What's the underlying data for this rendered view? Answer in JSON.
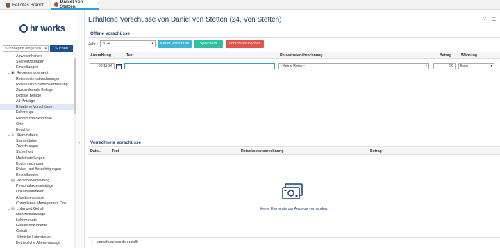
{
  "tabs": [
    {
      "label": "Felicitas Brandt"
    },
    {
      "label": "Daniel von Stetten",
      "close": "×"
    }
  ],
  "sidebar": {
    "logo": "hr works",
    "search_placeholder": "Suchbegriff eingeben",
    "search_button": "Suchen",
    "items": [
      {
        "label": "Abwesenheiten",
        "kind": "item"
      },
      {
        "label": "Stellvertretungen",
        "kind": "item"
      },
      {
        "label": "Einstellungen",
        "kind": "item"
      },
      {
        "label": "Reisemanagement",
        "kind": "group",
        "icon": "briefcase-icon"
      },
      {
        "label": "Reisekostenabrechnungen",
        "kind": "item"
      },
      {
        "label": "Reisekosten Sammelerfassung",
        "kind": "item"
      },
      {
        "label": "Zuzuordnende Belege",
        "kind": "item"
      },
      {
        "label": "Digitale Belege",
        "kind": "item"
      },
      {
        "label": "A1-Anträge",
        "kind": "item"
      },
      {
        "label": "Erhaltene Vorschüsse",
        "kind": "item",
        "selected": true
      },
      {
        "label": "Fahrzeuge",
        "kind": "item"
      },
      {
        "label": "Führerscheinkontrolle",
        "kind": "item"
      },
      {
        "label": "Orte",
        "kind": "item"
      },
      {
        "label": "Berichte",
        "kind": "item"
      },
      {
        "label": "Stammdaten",
        "kind": "group",
        "icon": "person-icon"
      },
      {
        "label": "Stammdaten",
        "kind": "item"
      },
      {
        "label": "Zuordnungen",
        "kind": "item"
      },
      {
        "label": "Sicherheit",
        "kind": "item"
      },
      {
        "label": "Maileinstellungen",
        "kind": "item"
      },
      {
        "label": "Kostenrechnung",
        "kind": "item"
      },
      {
        "label": "Rollen und Berechtigungen",
        "kind": "item"
      },
      {
        "label": "Einstellungen",
        "kind": "item"
      },
      {
        "label": "Personalverwaltung",
        "kind": "group",
        "icon": "idcard-icon"
      },
      {
        "label": "Personalakteneinträge",
        "kind": "item"
      },
      {
        "label": "Dokumentenkorb",
        "kind": "item"
      },
      {
        "label": "Arbeitszeugnisse",
        "kind": "item"
      },
      {
        "label": "Compliance Management Dok...",
        "kind": "item"
      },
      {
        "label": "Lohn und Gehalt",
        "kind": "group",
        "icon": "money-icon"
      },
      {
        "label": "Mahlzeitenbelege",
        "kind": "item"
      },
      {
        "label": "Lohnmonate",
        "kind": "item"
      },
      {
        "label": "Gehaltsdokumente",
        "kind": "item"
      },
      {
        "label": "Gehalt",
        "kind": "item"
      },
      {
        "label": "Jährliche Lohnsteuer",
        "kind": "item"
      },
      {
        "label": "Betriebliche Altersvorsorge",
        "kind": "item"
      }
    ]
  },
  "main": {
    "title": "Erhaltene Vorschüsse von Daniel von Stetten (24, Von Stetten)",
    "open_section": {
      "title": "Offene Vorschüsse",
      "year_label": "Jahr :",
      "year_value": "2024",
      "buttons": {
        "new": "Neuer Vorschuss",
        "save": "Speichern",
        "delete": "Vorschuss löschen"
      },
      "columns": [
        "Auszahlung ...",
        "Text",
        "Reisekostenabrechnung",
        "Betrag",
        "Währung"
      ],
      "row": {
        "date": "08.11.24",
        "text": "",
        "trip": "- Keine Reise -",
        "amount": "50",
        "currency": "Euro"
      }
    },
    "settled_section": {
      "title": "Verrechnete Vorschüsse",
      "columns": [
        "Datu...",
        "Text",
        "Reisekostenabrechnung",
        "Betrag"
      ],
      "empty_text": "Keine Elemente zur Anzeige vorhanden."
    },
    "status": "Vorschuss wurde erstellt"
  },
  "colors": {
    "brand": "#1d3f6e",
    "btn_new": "#3fb5d8",
    "btn_save": "#33c0a0",
    "btn_delete": "#e0564c"
  }
}
